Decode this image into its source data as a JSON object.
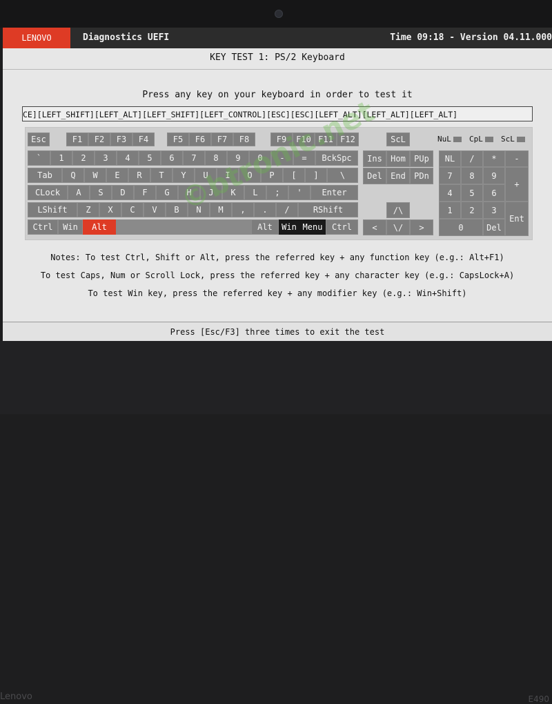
{
  "device": {
    "brand_bottom": "Lenovo",
    "model": "E490"
  },
  "header": {
    "brand": "LENOVO",
    "app_title": "Diagnostics UEFI",
    "time_version": "Time 09:18 - Version 04.11.000"
  },
  "test": {
    "subtitle": "KEY TEST 1: PS/2 Keyboard",
    "instruction": "Press any key on your keyboard in order to test it",
    "pressed_log": "CE][LEFT_SHIFT][LEFT_ALT][LEFT_SHIFT][LEFT_CONTROL][ESC][ESC][LEFT_ALT][LEFT_ALT][LEFT_ALT]"
  },
  "indicators": {
    "num": "NuL",
    "caps": "CpL",
    "scroll": "ScL"
  },
  "keyboard": {
    "f": {
      "esc": "Esc",
      "f1": "F1",
      "f2": "F2",
      "f3": "F3",
      "f4": "F4",
      "f5": "F5",
      "f6": "F6",
      "f7": "F7",
      "f8": "F8",
      "f9": "F9",
      "f10": "F10",
      "f11": "F11",
      "f12": "F12",
      "scl": "ScL"
    },
    "r1": {
      "grave": "`",
      "k1": "1",
      "k2": "2",
      "k3": "3",
      "k4": "4",
      "k5": "5",
      "k6": "6",
      "k7": "7",
      "k8": "8",
      "k9": "9",
      "k0": "0",
      "minus": "-",
      "equal": "=",
      "bksp": "BckSpc"
    },
    "r2": {
      "tab": "Tab",
      "q": "Q",
      "w": "W",
      "e": "E",
      "r": "R",
      "t": "T",
      "y": "Y",
      "u": "U",
      "i": "I",
      "o": "O",
      "p": "P",
      "lbr": "[",
      "rbr": "]",
      "bsl": "\\"
    },
    "r3": {
      "caps": "CLock",
      "a": "A",
      "s": "S",
      "d": "D",
      "f": "F",
      "g": "G",
      "h": "H",
      "j": "J",
      "k": "K",
      "l": "L",
      "semi": ";",
      "quote": "'",
      "enter": "Enter"
    },
    "r4": {
      "lshift": "LShift",
      "z": "Z",
      "x": "X",
      "c": "C",
      "v": "V",
      "b": "B",
      "n": "N",
      "m": "M",
      "comma": ",",
      "period": ".",
      "slash": "/",
      "rshift": "RShift"
    },
    "r5": {
      "lctrl": "Ctrl",
      "lwin": "Win",
      "lalt": "Alt",
      "ralt": "Alt",
      "rwin": "Win",
      "menu": "Menu",
      "rctrl": "Ctrl"
    },
    "nav": {
      "ins": "Ins",
      "home": "Hom",
      "pgup": "PUp",
      "del": "Del",
      "end": "End",
      "pgdn": "PDn"
    },
    "arrows": {
      "up": "/\\",
      "left": "<",
      "down": "\\/",
      "right": ">"
    },
    "numpad": {
      "nl": "NL",
      "div": "/",
      "mul": "*",
      "sub": "-",
      "n7": "7",
      "n8": "8",
      "n9": "9",
      "add": "+",
      "n4": "4",
      "n5": "5",
      "n6": "6",
      "n1": "1",
      "n2": "2",
      "n3": "3",
      "ent": "Ent",
      "n0": "0",
      "ndel": "Del"
    }
  },
  "notes": {
    "line1": "Notes: To test Ctrl, Shift or Alt, press the referred key + any function key (e.g.: Alt+F1)",
    "line2": "To test Caps, Num or Scroll Lock, press the referred key + any character key (e.g.: CapsLock+A)",
    "line3": "To test Win key, press the referred key + any modifier key (e.g.: Win+Shift)"
  },
  "footer": {
    "exit_hint": "Press [Esc/F3] three times to exit the test"
  },
  "watermark": "©btronic.net",
  "colors": {
    "accent": "#de3b25",
    "key": "#7d7d7d",
    "key_dark": "#1a1a1a",
    "screen_bg": "#e7e7e7",
    "titlebar": "#2c2c2c"
  }
}
